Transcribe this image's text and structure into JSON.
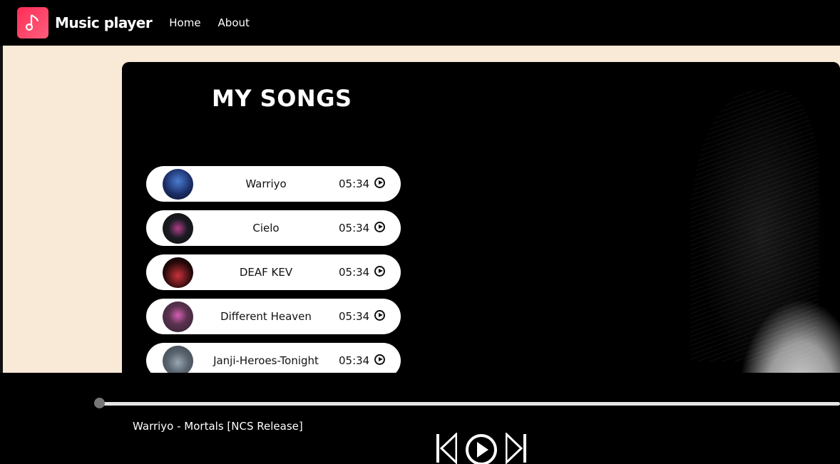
{
  "navbar": {
    "brand": "Music player",
    "links": [
      "Home",
      "About"
    ],
    "logo_icon": "music-note-icon"
  },
  "songs_panel": {
    "title": "MY SONGS",
    "songs": [
      {
        "name": "Warriyo",
        "duration": "05:34",
        "cover_colors": [
          "#1b2e68",
          "#4a7dd1"
        ]
      },
      {
        "name": "Cielo",
        "duration": "05:34",
        "cover_colors": [
          "#1a1a22",
          "#b13f88"
        ]
      },
      {
        "name": "DEAF KEV",
        "duration": "05:34",
        "cover_colors": [
          "#200808",
          "#c8323a"
        ]
      },
      {
        "name": "Different Heaven",
        "duration": "05:34",
        "cover_colors": [
          "#2b2030",
          "#d55fb4"
        ]
      },
      {
        "name": "Janji-Heroes-Tonight",
        "duration": "05:34",
        "cover_colors": [
          "#3a4047",
          "#98a7b2"
        ]
      }
    ]
  },
  "player": {
    "now_playing": "Warriyo - Mortals [NCS Release]",
    "progress_percent": 0,
    "controls": [
      "previous-icon",
      "play-icon",
      "next-icon"
    ]
  },
  "colors": {
    "background": "#f9e9d7",
    "panel": "#000000",
    "logo": "#ff2d55"
  }
}
